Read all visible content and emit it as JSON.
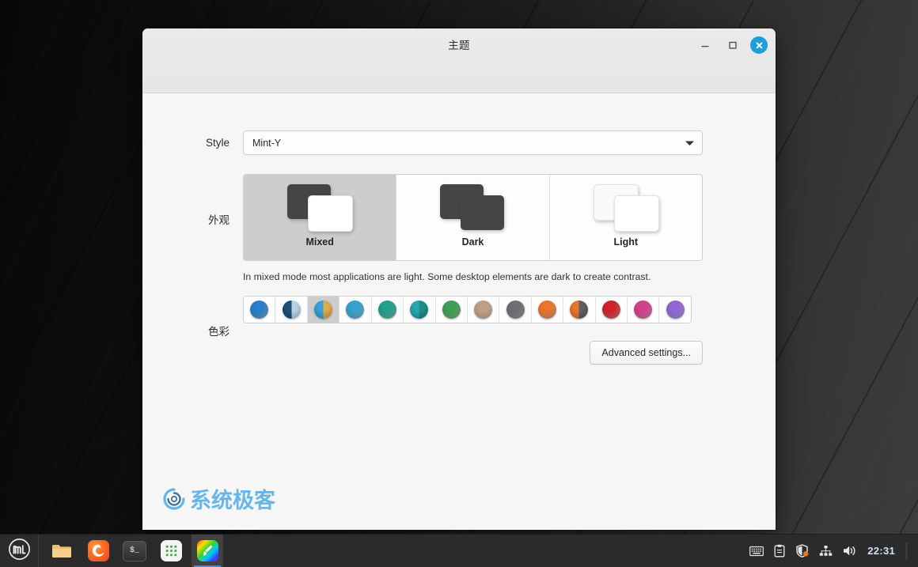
{
  "window": {
    "title": "主题",
    "controls": {
      "minimize": "−",
      "maximize": "□",
      "close": "✕"
    }
  },
  "form": {
    "style": {
      "label": "Style",
      "value": "Mint-Y"
    },
    "appearance": {
      "label": "外观",
      "options": [
        {
          "label": "Mixed",
          "selected": true
        },
        {
          "label": "Dark",
          "selected": false
        },
        {
          "label": "Light",
          "selected": false
        }
      ],
      "hint": "In mixed mode most applications are light. Some desktop elements are dark to create contrast."
    },
    "colors": {
      "label": "色彩",
      "selected_index": 2,
      "swatches": [
        {
          "name": "blue",
          "color": "#2a7fc9",
          "color2": ""
        },
        {
          "name": "blue-grey-split",
          "color": "#1f4f77",
          "color2": "#b9d4e6"
        },
        {
          "name": "blue-amber-split",
          "color": "#3aa3d6",
          "color2": "#e0ab4c"
        },
        {
          "name": "sky",
          "color": "#34a3cf",
          "color2": ""
        },
        {
          "name": "teal",
          "color": "#23a08f",
          "color2": ""
        },
        {
          "name": "teal-split",
          "color": "#2aa8b0",
          "color2": "#1c8f86"
        },
        {
          "name": "green",
          "color": "#3fa055",
          "color2": ""
        },
        {
          "name": "sand",
          "color": "#bfa183",
          "color2": ""
        },
        {
          "name": "grey",
          "color": "#6e7073",
          "color2": ""
        },
        {
          "name": "orange",
          "color": "#e8762d",
          "color2": ""
        },
        {
          "name": "orange-grey-split",
          "color": "#e8762d",
          "color2": "#5f6063"
        },
        {
          "name": "red",
          "color": "#d2232a",
          "color2": ""
        },
        {
          "name": "pink",
          "color": "#d4418b",
          "color2": ""
        },
        {
          "name": "purple",
          "color": "#9367d6",
          "color2": ""
        }
      ]
    },
    "advanced_button": "Advanced settings..."
  },
  "watermark": {
    "text": "系统极客"
  },
  "taskbar": {
    "menu": "mint-menu-icon",
    "launchers": [
      {
        "name": "files",
        "icon": "folder-icon",
        "active": false
      },
      {
        "name": "firefox",
        "icon": "firefox-icon",
        "active": false
      },
      {
        "name": "terminal",
        "icon": "terminal-icon",
        "active": false
      },
      {
        "name": "applications",
        "icon": "app-grid-icon",
        "active": false
      },
      {
        "name": "themes",
        "icon": "theme-brush-icon",
        "active": true
      }
    ],
    "tray": [
      {
        "name": "keyboard-layout-icon"
      },
      {
        "name": "clipboard-icon"
      },
      {
        "name": "update-shield-icon"
      },
      {
        "name": "network-icon"
      },
      {
        "name": "volume-icon"
      }
    ],
    "clock": "22:31"
  }
}
